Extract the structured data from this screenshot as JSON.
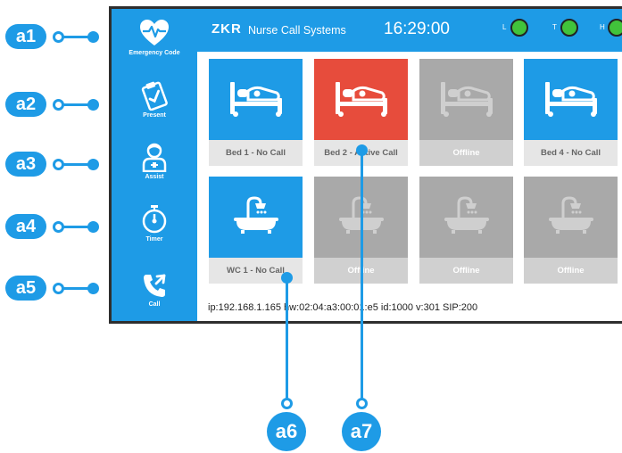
{
  "sidebar": {
    "items": [
      {
        "label": "Emergency Code",
        "icon": "heart-pulse-icon"
      },
      {
        "label": "Present",
        "icon": "clipboard-check-icon"
      },
      {
        "label": "Assist",
        "icon": "nurse-icon"
      },
      {
        "label": "Timer",
        "icon": "stopwatch-icon"
      },
      {
        "label": "Call",
        "icon": "phone-call-icon"
      }
    ]
  },
  "header": {
    "logo": "ZKR",
    "title": "Nurse Call Systems",
    "clock": "16:29:00",
    "indicators": [
      {
        "letter": "L",
        "color": "#41c33b"
      },
      {
        "letter": "T",
        "color": "#41c33b"
      },
      {
        "letter": "H",
        "color": "#41c33b"
      }
    ]
  },
  "tiles": [
    {
      "label": "Bed 1 - No Call",
      "icon": "bed-icon",
      "state": "blue"
    },
    {
      "label": "Bed 2 - Active Call",
      "icon": "bed-icon",
      "state": "red"
    },
    {
      "label": "Offline",
      "icon": "bed-icon",
      "state": "gray"
    },
    {
      "label": "Bed 4 - No Call",
      "icon": "bed-icon",
      "state": "blue"
    },
    {
      "label": "WC 1 - No Call",
      "icon": "bathtub-icon",
      "state": "blue"
    },
    {
      "label": "Offline",
      "icon": "bathtub-icon",
      "state": "gray"
    },
    {
      "label": "Offline",
      "icon": "bathtub-icon",
      "state": "gray"
    },
    {
      "label": "Offline",
      "icon": "bathtub-icon",
      "state": "gray"
    }
  ],
  "status": {
    "line": "ip:192.168.1.165  hw:02:04:a3:00:01:e5  id:1000  v:301  SIP:200"
  },
  "callouts": {
    "a1": "a1",
    "a2": "a2",
    "a3": "a3",
    "a4": "a4",
    "a5": "a5",
    "a6": "a6",
    "a7": "a7"
  },
  "colors": {
    "accent": "#1e9be6",
    "active_call": "#e74c3c",
    "offline": "#a9a9a9",
    "indicator_ok": "#41c33b"
  }
}
